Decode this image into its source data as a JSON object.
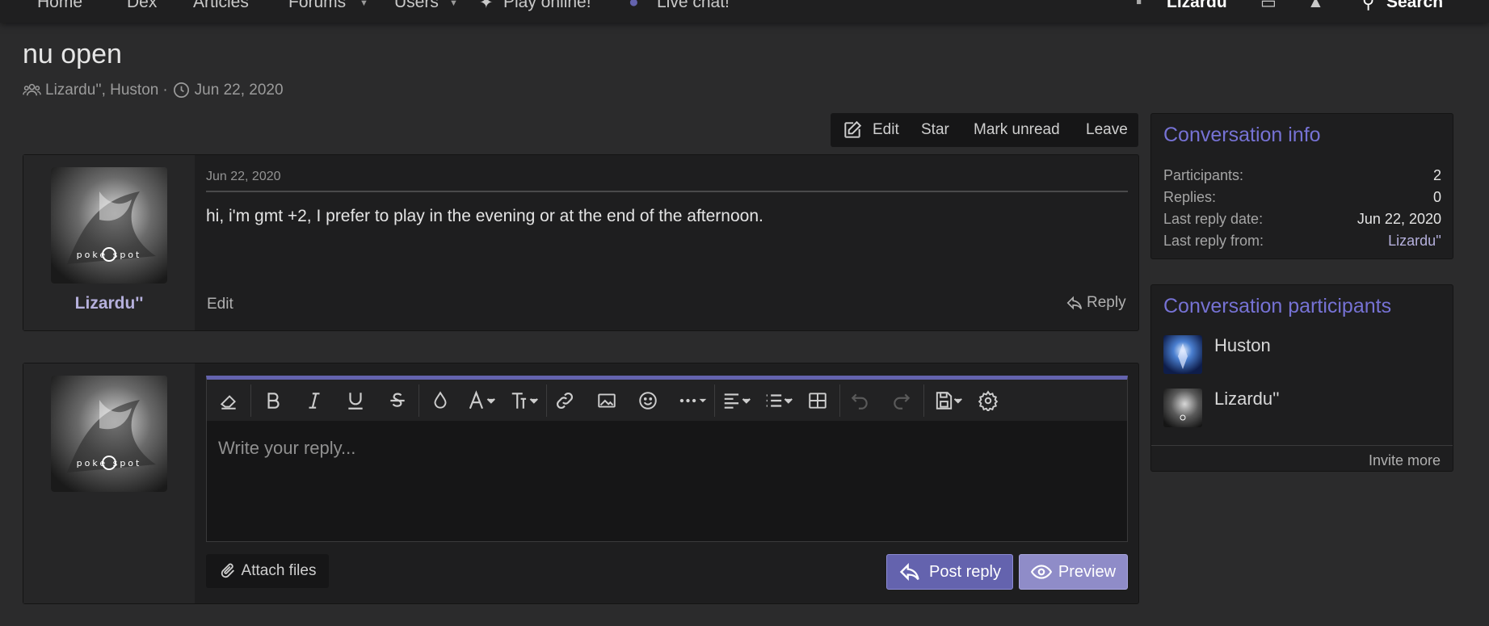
{
  "nav": {
    "items": [
      "Home",
      "Dex",
      "Articles",
      "Forums",
      "Users",
      "Play online!",
      "Live chat!"
    ],
    "username": "Lizardu''",
    "search_label": "Search"
  },
  "page": {
    "title": "nu open",
    "participants_text": "Lizardu'', Huston",
    "separator": "·",
    "date": "Jun 22, 2020"
  },
  "actions": {
    "edit": "Edit",
    "star": "Star",
    "mark_unread": "Mark unread",
    "leave": "Leave"
  },
  "message": {
    "author": "Lizardu''",
    "date": "Jun 22, 2020",
    "body": "hi, i'm gmt +2, I prefer to play in the evening or at the end of the afternoon.",
    "edit_label": "Edit",
    "reply_label": "Reply",
    "avatar_text": "poke spot"
  },
  "composer": {
    "placeholder": "Write your reply...",
    "attach_label": "Attach files",
    "post_label": "Post reply",
    "preview_label": "Preview",
    "toolbar_icons": [
      "eraser-icon",
      "bold-icon",
      "italic-icon",
      "underline-icon",
      "strikethrough-icon",
      "text-color-icon",
      "font-family-icon",
      "font-size-icon",
      "link-icon",
      "image-icon",
      "smilie-icon",
      "more-icon",
      "align-icon",
      "list-icon",
      "table-icon",
      "undo-icon",
      "redo-icon",
      "drafts-icon",
      "settings-icon"
    ]
  },
  "conversation_info": {
    "title": "Conversation info",
    "rows": [
      {
        "label": "Participants:",
        "value": "2"
      },
      {
        "label": "Replies:",
        "value": "0"
      },
      {
        "label": "Last reply date:",
        "value": "Jun 22, 2020"
      },
      {
        "label": "Last reply from:",
        "value": "Lizardu''"
      }
    ]
  },
  "participants_block": {
    "title": "Conversation participants",
    "people": [
      "Huston",
      "Lizardu''"
    ],
    "invite_label": "Invite more"
  },
  "colors": {
    "accent": "#6463ae",
    "heading": "#7672d4",
    "username": "#b5b0dc",
    "background": "#2b2b2c"
  }
}
